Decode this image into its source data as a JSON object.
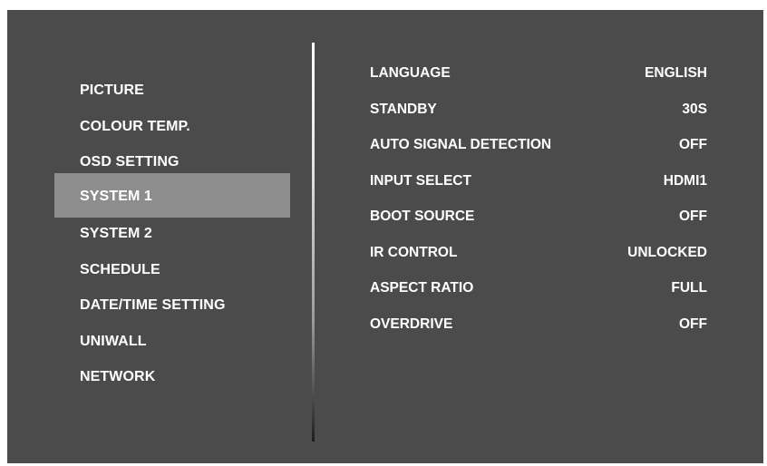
{
  "menu": {
    "items": [
      {
        "label": "PICTURE",
        "selected": false
      },
      {
        "label": "COLOUR TEMP.",
        "selected": false
      },
      {
        "label": "OSD SETTING",
        "selected": false
      },
      {
        "label": "SYSTEM 1",
        "selected": true
      },
      {
        "label": "SYSTEM 2",
        "selected": false
      },
      {
        "label": "SCHEDULE",
        "selected": false
      },
      {
        "label": "DATE/TIME SETTING",
        "selected": false
      },
      {
        "label": "UNIWALL",
        "selected": false
      },
      {
        "label": "NETWORK",
        "selected": false
      }
    ]
  },
  "settings": {
    "rows": [
      {
        "label": "LANGUAGE",
        "value": "ENGLISH"
      },
      {
        "label": "STANDBY",
        "value": "30S"
      },
      {
        "label": "AUTO SIGNAL DETECTION",
        "value": "OFF"
      },
      {
        "label": "INPUT SELECT",
        "value": "HDMI1"
      },
      {
        "label": "BOOT SOURCE",
        "value": "OFF"
      },
      {
        "label": "IR CONTROL",
        "value": "UNLOCKED"
      },
      {
        "label": "ASPECT RATIO",
        "value": "FULL"
      },
      {
        "label": "OVERDRIVE",
        "value": "OFF"
      }
    ]
  },
  "colors": {
    "screen_background": "#4b4b4b",
    "selected_highlight": "#8d8d8d",
    "text": "#ffffff"
  }
}
